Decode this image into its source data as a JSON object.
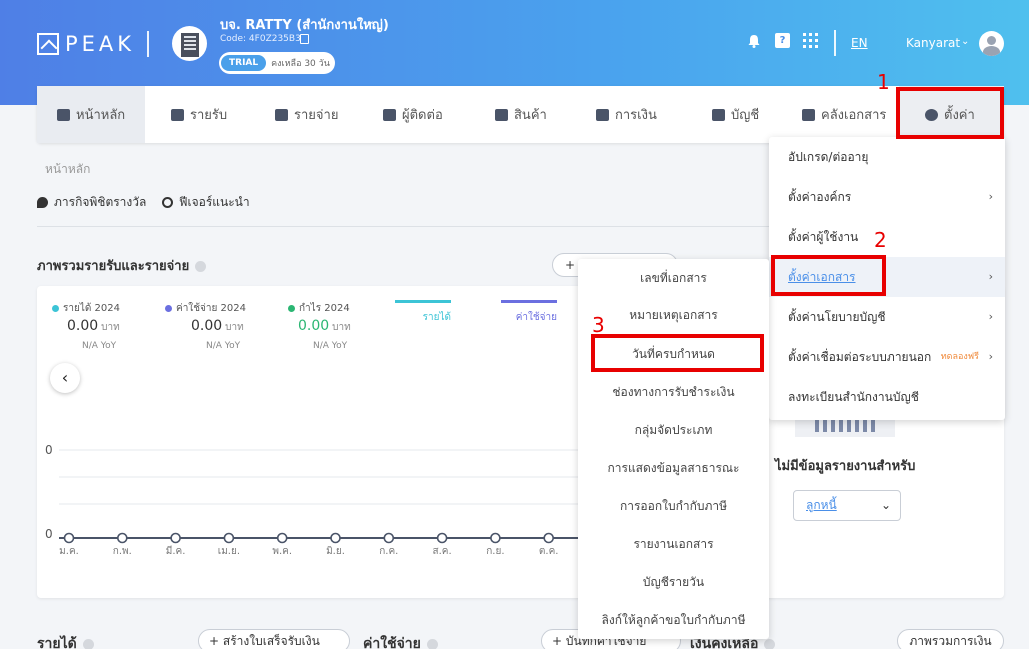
{
  "header": {
    "logo_text": "PEAK",
    "company_name": "บจ. RATTY (สำนักงานใหญ่)",
    "company_code": "Code: 4F0Z235B3",
    "trial_badge": "TRIAL",
    "trial_remaining": "คงเหลือ 30 วัน",
    "qa_icon_text": "?",
    "language": "EN",
    "user_name": "Kanyarat"
  },
  "nav": {
    "items": [
      {
        "label": "หน้าหลัก",
        "icon": "dashboard-icon"
      },
      {
        "label": "รายรับ",
        "icon": "income-icon"
      },
      {
        "label": "รายจ่าย",
        "icon": "expense-icon"
      },
      {
        "label": "ผู้ติดต่อ",
        "icon": "contact-icon"
      },
      {
        "label": "สินค้า",
        "icon": "product-icon"
      },
      {
        "label": "การเงิน",
        "icon": "money-icon"
      },
      {
        "label": "บัญชี",
        "icon": "account-icon"
      },
      {
        "label": "คลังเอกสาร",
        "icon": "folder-icon"
      },
      {
        "label": "ตั้งค่า",
        "icon": "gear-icon"
      }
    ]
  },
  "page": {
    "breadcrumb": "หน้าหลัก",
    "quick_links": [
      "ภารกิจพิชิตรางวัล",
      "ฟีเจอร์แนะนำ"
    ],
    "section_title": "ภาพรวมรายรับและรายจ่าย",
    "add_button_prefix": "+"
  },
  "chart_data": {
    "type": "line",
    "categories": [
      "ม.ค.",
      "ก.พ.",
      "มี.ค.",
      "เม.ย.",
      "พ.ค.",
      "มิ.ย.",
      "ก.ค.",
      "ส.ค.",
      "ก.ย.",
      "ต.ค."
    ],
    "series": [
      {
        "name": "รายได้",
        "values": [
          0,
          0,
          0,
          0,
          0,
          0,
          0,
          0,
          0,
          0
        ]
      }
    ],
    "yticks": [
      "0",
      "0"
    ],
    "legend": [
      {
        "label": "รายได้ 2024",
        "value": "0.00",
        "unit": "บาท",
        "yoy": "N/A YoY",
        "color": "#3cc4d6"
      },
      {
        "label": "ค่าใช้จ่าย 2024",
        "value": "0.00",
        "unit": "บาท",
        "yoy": "N/A YoY",
        "color": "#6b6fe0"
      },
      {
        "label": "กำไร 2024",
        "value": "0.00",
        "unit": "บาท",
        "yoy": "N/A YoY",
        "color": "#2bb673"
      }
    ],
    "series_tabs": [
      {
        "label": "รายได้",
        "color": "#3cc4d6"
      },
      {
        "label": "ค่าใช้จ่าย",
        "color": "#6b6fe0"
      }
    ]
  },
  "right_panel": {
    "no_data_text": "ไม่มีข้อมูลรายงานสำหรับ",
    "select_value": "ลูกหนี้"
  },
  "bottom": {
    "income_label": "รายได้",
    "income_button": "+ สร้างใบเสร็จรับเงิน",
    "expense_label": "ค่าใช้จ่าย",
    "expense_button": "+ บันทึกค่าใช้จ่าย",
    "third_label": "เงินคงเหลือ",
    "overview_button": "ภาพรวมการเงิน"
  },
  "settings_menu": {
    "items": [
      {
        "label": "อัปเกรด/ต่ออายุ",
        "arrow": ""
      },
      {
        "label": "ตั้งค่าองค์กร",
        "arrow": "›"
      },
      {
        "label": "ตั้งค่าผู้ใช้งาน",
        "arrow": ""
      },
      {
        "label": "ตั้งค่าเอกสาร",
        "arrow": "›"
      },
      {
        "label": "ตั้งค่านโยบายบัญชี",
        "arrow": "›"
      },
      {
        "label": "ตั้งค่าเชื่อมต่อระบบภายนอก",
        "arrow": "›",
        "tag": "ทดลองฟรี"
      },
      {
        "label": "ลงทะเบียนสำนักงานบัญชี",
        "arrow": ""
      }
    ]
  },
  "document_menu": {
    "items": [
      "เลขที่เอกสาร",
      "หมายเหตุเอกสาร",
      "วันที่ครบกำหนด",
      "ช่องทางการรับชำระเงิน",
      "กลุ่มจัดประเภท",
      "การแสดงข้อมูลสาธารณะ",
      "การออกใบกำกับภาษี",
      "รายงานเอกสาร",
      "บัญชีรายวัน",
      "ลิงก์ให้ลูกค้าขอใบกำกับภาษี"
    ]
  },
  "annotations": {
    "step1": "1",
    "step2": "2",
    "step3": "3",
    "color": "#e80000"
  }
}
